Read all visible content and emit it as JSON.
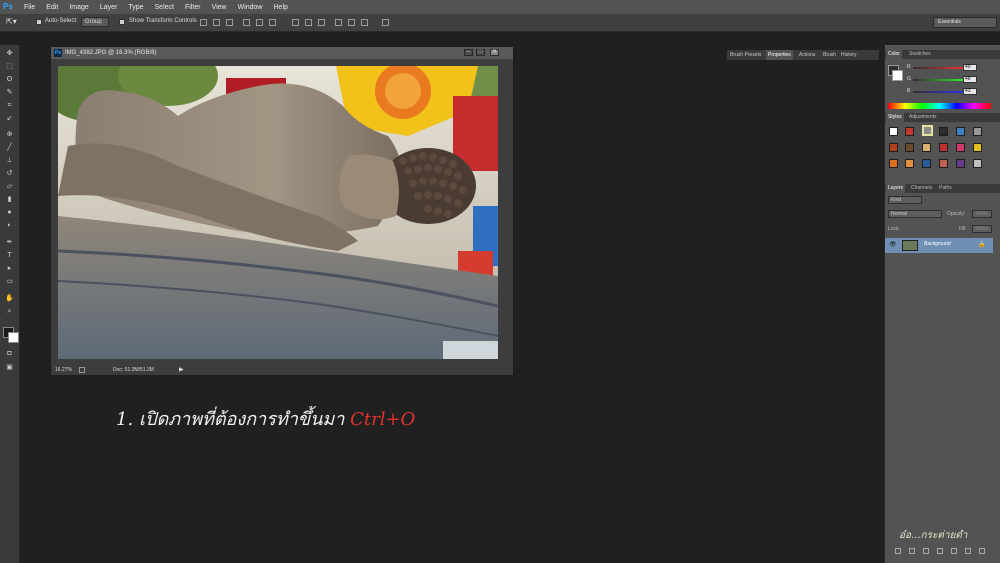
{
  "app": {
    "logo": "Ps"
  },
  "menu": [
    "File",
    "Edit",
    "Image",
    "Layer",
    "Type",
    "Select",
    "Filter",
    "View",
    "Window",
    "Help"
  ],
  "options_bar": {
    "auto_select_label": "Auto-Select:",
    "auto_select_value": "Group",
    "show_transform_label": "Show Transform Controls",
    "workspace": "Essentials"
  },
  "document": {
    "title": "IMG_4382.JPG @ 16.3% (RGB/8)",
    "zoom": "16.27%",
    "doc_size": "Doc: 51.3M/51.3M",
    "tab_icon": "Ps"
  },
  "panel_tabs_mid": [
    "Brush Presets",
    "Properties",
    "Actions",
    "Brush",
    "History"
  ],
  "color_panel": {
    "tabs": [
      "Color",
      "Swatches"
    ],
    "r_label": "R",
    "g_label": "G",
    "b_label": "B",
    "r": "49",
    "g": "48",
    "b": "43"
  },
  "styles_panel": {
    "tabs": [
      "Styles",
      "Adjustments"
    ]
  },
  "layers_panel": {
    "tabs": [
      "Layers",
      "Channels",
      "Paths"
    ],
    "kind": "Kind",
    "blend_mode": "Normal",
    "opacity_label": "Opacity:",
    "opacity_value": "100%",
    "lock_label": "Lock:",
    "fill_label": "Fill:",
    "fill_value": "100%",
    "layer_name": "Background"
  },
  "caption": {
    "text": "1. เปิดภาพที่ต้องการทำขึ้นมา ",
    "shortcut": "Ctrl+O"
  },
  "watermark": "อ๋อ...กระต่ายดำ",
  "colors": {
    "accent_red": "#e0332b",
    "layer_highlight": "#6f8fb5"
  }
}
